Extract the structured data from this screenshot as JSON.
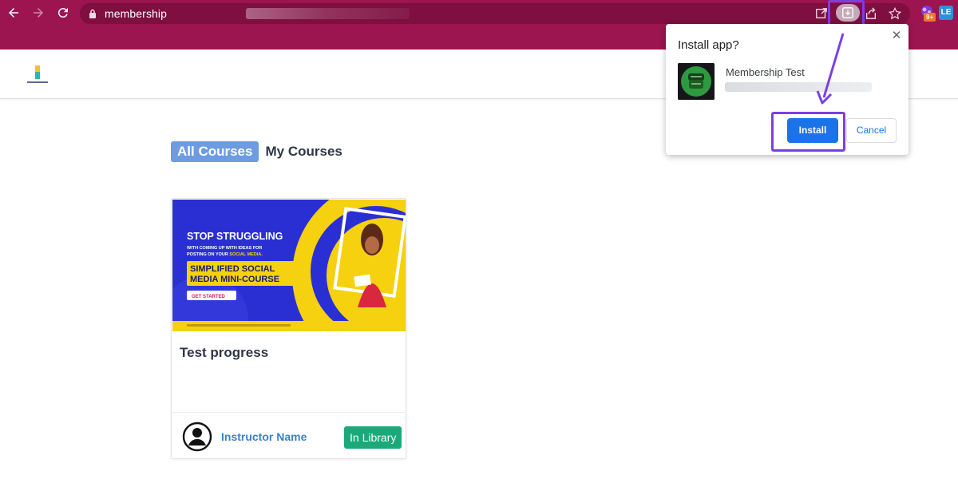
{
  "browser": {
    "url_text": "membership",
    "nav_icons": [
      "back-arrow-icon",
      "forward-arrow-icon",
      "reload-icon"
    ],
    "toolbar_color": "#9c1450",
    "extension_badge": "9+",
    "extension_b_text": "LE"
  },
  "page": {
    "tabs": [
      {
        "label": "All Courses",
        "active": true
      },
      {
        "label": "My Courses",
        "active": false
      }
    ],
    "course_card": {
      "title": "Test progress",
      "instructor": "Instructor Name",
      "badge": "In Library",
      "thumbnail": {
        "headline": "STOP STRUGGLING",
        "subline_1": "WITH COMING UP WITH IDEAS FOR",
        "subline_2_prefix": "POSTING ON YOUR",
        "subline_2_emph": "SOCIAL MEDIA.",
        "course_line_1": "SIMPLIFIED SOCIAL",
        "course_line_2": "MEDIA MINI-COURSE",
        "cta": "GET STARTED"
      }
    }
  },
  "install_popup": {
    "title": "Install app?",
    "app_name": "Membership Test",
    "install_label": "Install",
    "cancel_label": "Cancel",
    "close_glyph": "✕"
  },
  "colors": {
    "accent_highlight": "#7b3fe4",
    "primary_blue": "#1a73e8",
    "tab_active": "#6e9ce0",
    "badge_green": "#1aaa7a"
  }
}
